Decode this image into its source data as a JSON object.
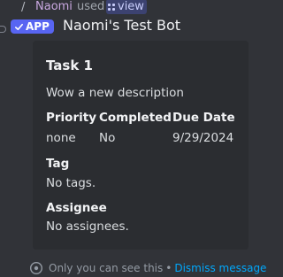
{
  "reply": {
    "slash": "/",
    "user": "Naomi",
    "used": "used",
    "command": "view"
  },
  "header": {
    "badge_label": "APP",
    "bot_name": "Naomi's Test Bot"
  },
  "embed": {
    "title": "Task 1",
    "description": "Wow a new description",
    "fields": {
      "priority": {
        "name": "Priority",
        "value": "none"
      },
      "completed": {
        "name": "Completed",
        "value": "No"
      },
      "due_date": {
        "name": "Due Date",
        "value": "9/29/2024"
      },
      "tag": {
        "name": "Tag",
        "value": "No tags."
      },
      "assignee": {
        "name": "Assignee",
        "value": "No assignees."
      }
    }
  },
  "footer": {
    "notice": "Only you can see this",
    "separator": "•",
    "dismiss": "Dismiss message"
  },
  "colors": {
    "background": "#313338",
    "embed_background": "#2b2d31",
    "app_badge": "#5865f2",
    "username": "#c9a8e0",
    "link": "#00a8fc"
  }
}
